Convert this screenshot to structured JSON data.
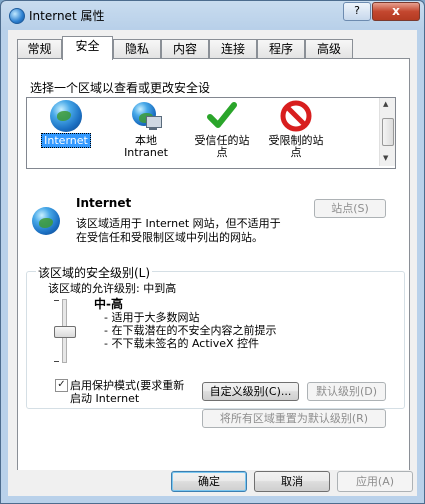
{
  "window": {
    "title": "Internet 属性",
    "help_label": "?",
    "close_label": "x"
  },
  "tabs": [
    {
      "label": "常规",
      "active": false
    },
    {
      "label": "安全",
      "active": true
    },
    {
      "label": "隐私",
      "active": false
    },
    {
      "label": "内容",
      "active": false
    },
    {
      "label": "连接",
      "active": false
    },
    {
      "label": "程序",
      "active": false
    },
    {
      "label": "高级",
      "active": false
    }
  ],
  "security": {
    "zone_prompt": "选择一个区域以查看或更改安全设",
    "zones": [
      {
        "line1": "Internet",
        "line2": "",
        "icon": "globe-icon",
        "selected": true
      },
      {
        "line1": "本地",
        "line2": "Intranet",
        "icon": "local-intranet-icon",
        "selected": false
      },
      {
        "line1": "受信任的站",
        "line2": "点",
        "icon": "trusted-check-icon",
        "selected": false
      },
      {
        "line1": "受限制的站",
        "line2": "点",
        "icon": "restricted-no-icon",
        "selected": false
      }
    ],
    "zone_name": "Internet",
    "zone_desc1": "该区域适用于 Internet 网站，但不适用于",
    "zone_desc2": "在受信任和受限制区域中列出的网站。",
    "sites_button": "站点(S)",
    "level_group_title": "该区域的安全级别(L)",
    "allowed_levels": "该区域的允许级别: 中到高",
    "level_name": "中-高",
    "level_bullets": [
      "- 适用于大多数网站",
      "- 在下载潜在的不安全内容之前提示",
      "- 不下载未签名的 ActiveX 控件"
    ],
    "slider_level_fraction": 0.5,
    "protected_mode_line1": "启用保护模式(要求重新",
    "protected_mode_line2": "启动 Internet",
    "protected_mode_checked": true,
    "custom_level_button": "自定义级别(C)...",
    "default_level_button": "默认级别(D)",
    "reset_all_button": "将所有区域重置为默认级别(R)"
  },
  "footer": {
    "ok": "确定",
    "cancel": "取消",
    "apply": "应用(A)"
  },
  "colors": {
    "title_bar": "#b9d1ea",
    "selection": "#3399ff",
    "close": "#c4472f",
    "check_green": "#2aa52a",
    "no_red": "#d81e1e"
  }
}
